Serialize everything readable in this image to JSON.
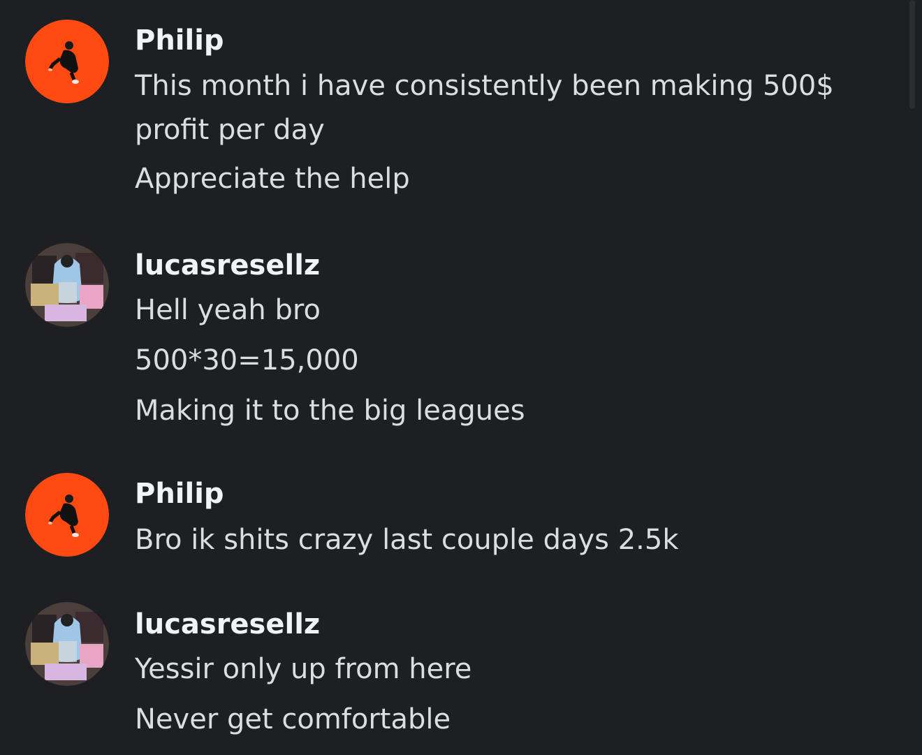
{
  "messages": [
    {
      "author": "Philip",
      "avatar": "orange-figure-avatar",
      "lines": [
        "This month i have consistently been making 500$ profit per day",
        "Appreciate the help"
      ]
    },
    {
      "author": "lucasresellz",
      "avatar": "clothing-pile-avatar",
      "lines": [
        "Hell yeah bro",
        "500*30=15,000",
        "Making it to the big leagues"
      ]
    },
    {
      "author": "Philip",
      "avatar": "orange-figure-avatar",
      "lines": [
        "Bro ik shits crazy last couple days 2.5k"
      ]
    },
    {
      "author": "lucasresellz",
      "avatar": "clothing-pile-avatar",
      "lines": [
        "Yessir only up from here",
        "Never get comfortable"
      ]
    }
  ],
  "colors": {
    "background": "#1e1f22",
    "username": "#f2f3f5",
    "text": "#dbdee1",
    "philip_avatar": "#ff4a12"
  }
}
